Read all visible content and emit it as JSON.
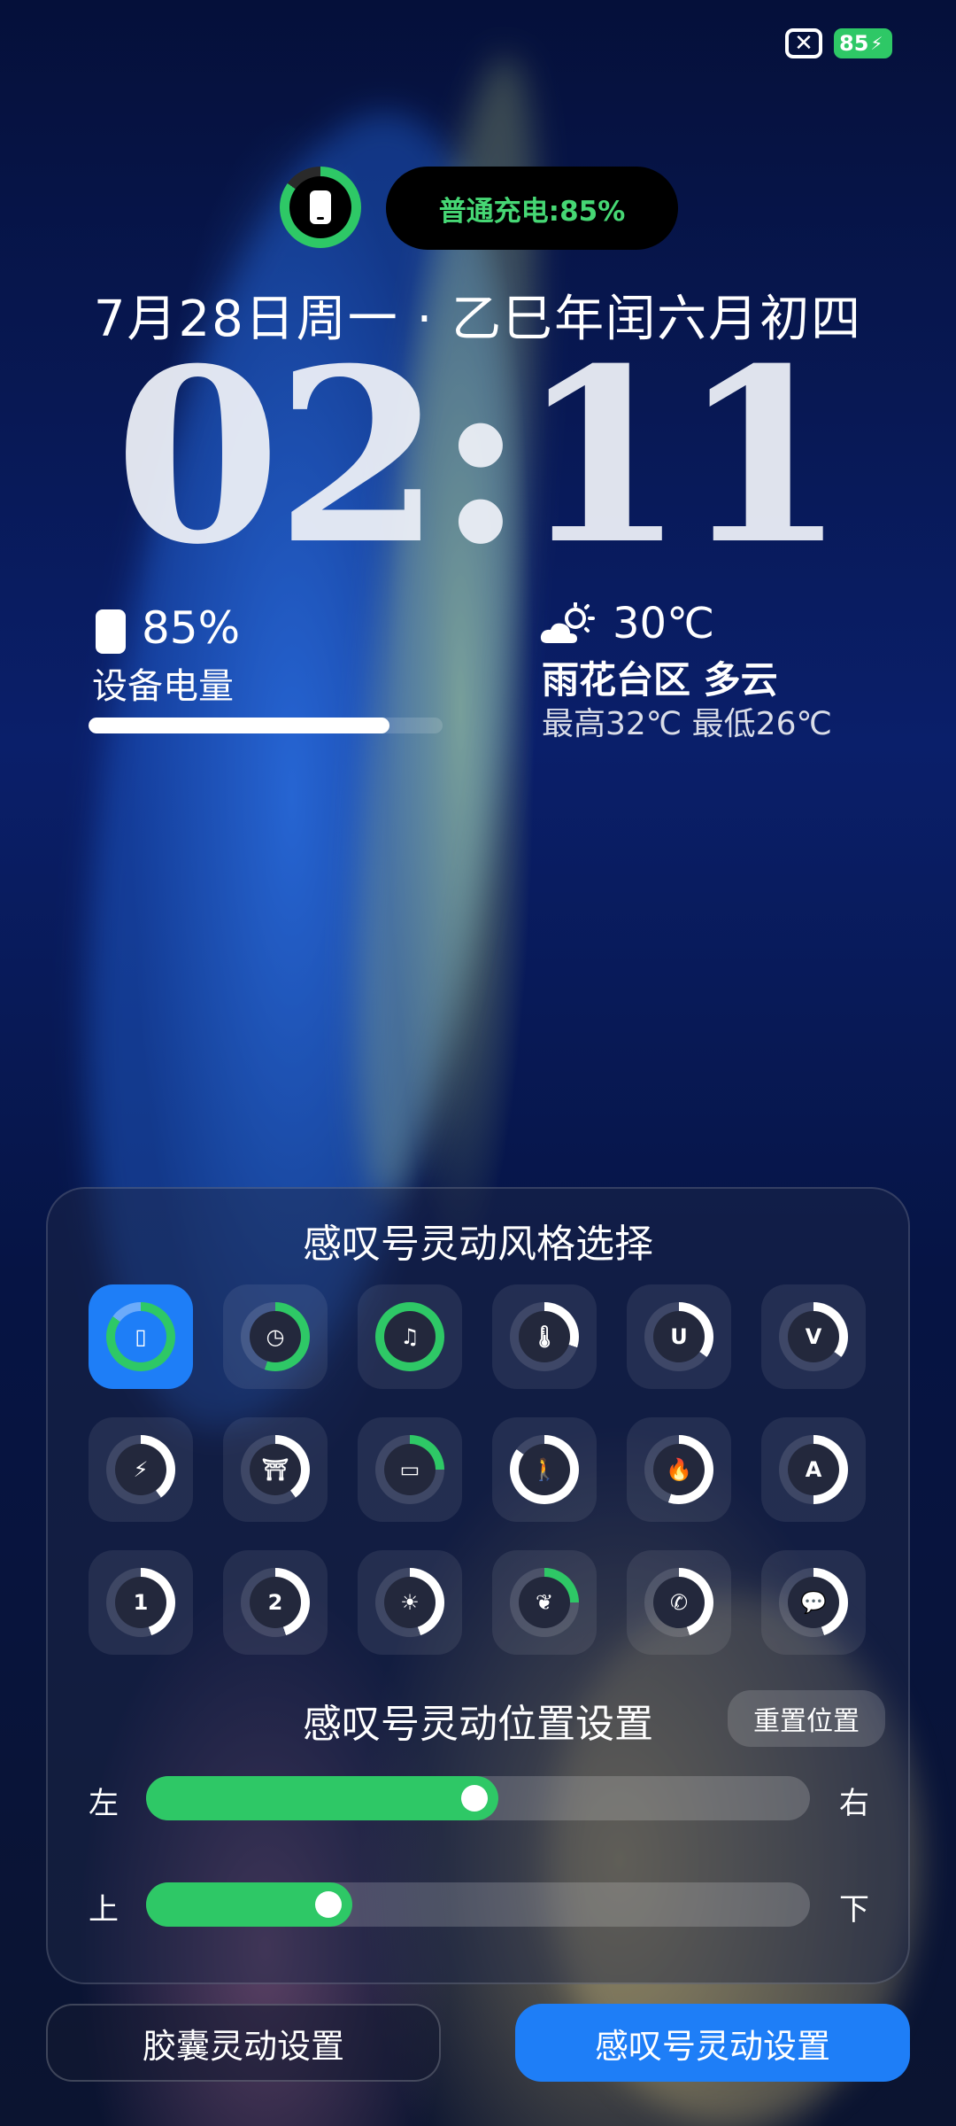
{
  "status_bar": {
    "close_glyph": "✕",
    "battery_level": "85"
  },
  "charging": {
    "label": "普通充电:85%",
    "level": 0.85
  },
  "lockscreen": {
    "date": "7月28日周一 · 乙巳年闰六月初四",
    "time": "02:11"
  },
  "battery_widget": {
    "percent": "85%",
    "label": "设备电量",
    "level": 0.85
  },
  "weather_widget": {
    "icon": "partly-cloudy-icon",
    "temperature": "30℃",
    "location": "雨花台区 多云",
    "high_low": "最高32℃ 最低26℃"
  },
  "style_panel": {
    "title": "感叹号灵动风格选择",
    "styles": [
      {
        "icon": "phone-icon",
        "glyph": "▯",
        "level": 0.85,
        "color": "#2ec866",
        "selected": true
      },
      {
        "icon": "watch-icon",
        "glyph": "◷",
        "level": 0.55,
        "color": "#2ec866"
      },
      {
        "icon": "earbuds-icon",
        "glyph": "♫",
        "level": 1.0,
        "color": "#2ec866"
      },
      {
        "icon": "thermometer-icon",
        "glyph": "🌡",
        "level": 0.3,
        "color": "#ffffff"
      },
      {
        "icon": "u-letter-icon",
        "glyph": "U",
        "level": 0.35,
        "color": "#ffffff"
      },
      {
        "icon": "v-letter-icon",
        "glyph": "V",
        "level": 0.35,
        "color": "#ffffff"
      },
      {
        "icon": "bolt-icon",
        "glyph": "⚡",
        "level": 0.4,
        "color": "#ffffff"
      },
      {
        "icon": "gate-icon",
        "glyph": "⛩",
        "level": 0.4,
        "color": "#ffffff"
      },
      {
        "icon": "battery-icon",
        "glyph": "▭",
        "level": 0.25,
        "color": "#2ec866"
      },
      {
        "icon": "walker-icon",
        "glyph": "🚶",
        "level": 0.85,
        "color": "#ffffff"
      },
      {
        "icon": "flame-icon",
        "glyph": "🔥",
        "level": 0.55,
        "color": "#ffffff"
      },
      {
        "icon": "road-icon",
        "glyph": "A",
        "level": 0.5,
        "color": "#ffffff"
      },
      {
        "icon": "number-1-icon",
        "glyph": "1",
        "level": 0.45,
        "color": "#ffffff"
      },
      {
        "icon": "number-2-icon",
        "glyph": "2",
        "level": 0.45,
        "color": "#ffffff"
      },
      {
        "icon": "sun-icon",
        "glyph": "☀",
        "level": 0.45,
        "color": "#ffffff"
      },
      {
        "icon": "leaf-icon",
        "glyph": "❦",
        "level": 0.25,
        "color": "#2ec866"
      },
      {
        "icon": "phone-call-icon",
        "glyph": "✆",
        "level": 0.45,
        "color": "#ffffff"
      },
      {
        "icon": "chat-bubble-icon",
        "glyph": "💬",
        "level": 0.45,
        "color": "#ffffff"
      }
    ]
  },
  "position_panel": {
    "title": "感叹号灵动位置设置",
    "reset_label": "重置位置",
    "horizontal": {
      "left_label": "左",
      "right_label": "右",
      "value": 0.53
    },
    "vertical": {
      "top_label": "上",
      "bottom_label": "下",
      "value": 0.31
    }
  },
  "bottom_buttons": {
    "capsule_label": "胶囊灵动设置",
    "exclaim_label": "感叹号灵动设置"
  },
  "colors": {
    "accent_green": "#2ec866",
    "accent_blue": "#1e7ef7"
  }
}
